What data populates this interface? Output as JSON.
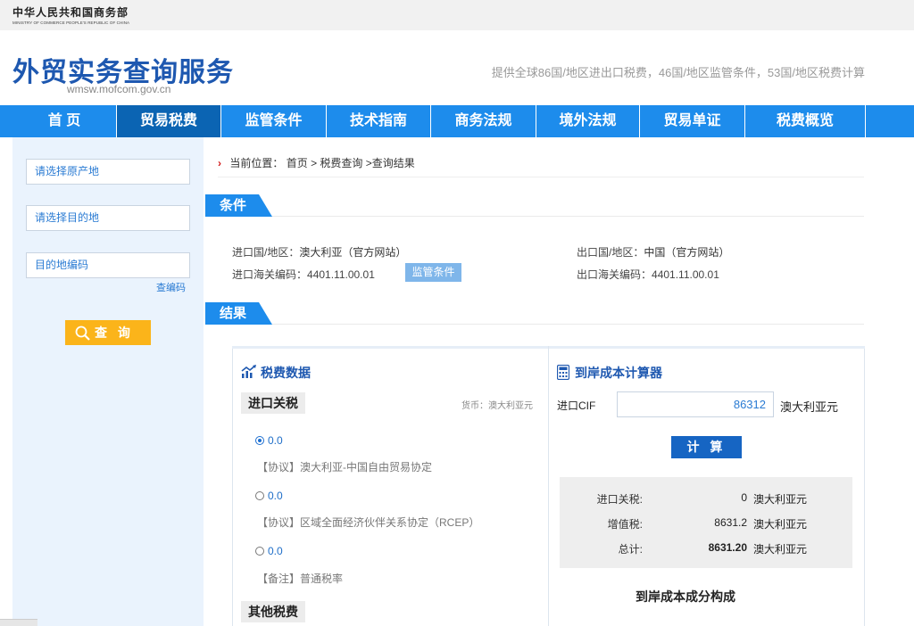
{
  "header": {
    "ministry_cn": "中华人民共和国商务部",
    "ministry_en": "MINISTRY OF COMMERCE PEOPLE'S REPUBLIC OF CHINA",
    "site_title": "外贸实务查询服务",
    "site_domain": "wmsw.mofcom.gov.cn",
    "tagline": "提供全球86国/地区进出口税费，46国/地区监管条件，53国/地区税费计算"
  },
  "nav": {
    "items": [
      "首 页",
      "贸易税费",
      "监管条件",
      "技术指南",
      "商务法规",
      "境外法规",
      "贸易单证",
      "税费概览"
    ],
    "active_index": 1
  },
  "sidebar": {
    "origin_placeholder": "请选择原产地",
    "destination_placeholder": "请选择目的地",
    "code_placeholder": "目的地编码",
    "code_lookup_link": "查编码",
    "search_button": "查 询"
  },
  "breadcrumb": {
    "prefix": "当前位置：",
    "items": [
      "首页",
      ">",
      "税费查询",
      ">查询结果"
    ]
  },
  "conditions": {
    "section_title": "条件",
    "import_country_label": "进口国/地区：",
    "import_country_value": "澳大利亚（官方网站）",
    "export_country_label": "出口国/地区：",
    "export_country_value": "中国（官方网站）",
    "import_code_label": "进口海关编码：",
    "import_code_value": "4401.11.00.01",
    "export_code_label": "出口海关编码：",
    "export_code_value": "4401.11.00.01",
    "supervision_button": "监管条件"
  },
  "results": {
    "section_title": "结果",
    "tax_panel_title": "税费数据",
    "import_tariff_tab": "进口关税",
    "currency_note": "货币：澳大利亚元",
    "rates": [
      {
        "value": "0.0",
        "selected": true,
        "note": "【协议】澳大利亚-中国自由贸易协定"
      },
      {
        "value": "0.0",
        "selected": false,
        "note": "【协议】区域全面经济伙伴关系协定（RCEP）"
      },
      {
        "value": "0.0",
        "selected": false,
        "note": "【备注】普通税率"
      }
    ],
    "other_taxes_tab": "其他税费"
  },
  "calculator": {
    "title": "到岸成本计算器",
    "cif_label": "进口CIF",
    "cif_value": "86312",
    "cif_unit": "澳大利亚元",
    "calc_button": "计 算",
    "rows": [
      {
        "label": "进口关税:",
        "value": "0",
        "unit": "澳大利亚元"
      },
      {
        "label": "增值税:",
        "value": "8631.2",
        "unit": "澳大利亚元"
      },
      {
        "label": "总计:",
        "value": "8631.20",
        "unit": "澳大利亚元"
      }
    ],
    "cost_breakdown_title": "到岸成本成分构成"
  },
  "colors": {
    "nav_blue": "#1d8cec",
    "nav_active": "#0b64b3",
    "title_blue": "#1e58b0",
    "search_orange": "#fbb41a",
    "calc_button": "#1665c3"
  }
}
